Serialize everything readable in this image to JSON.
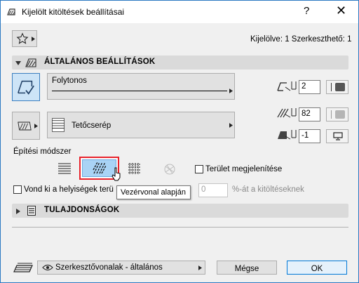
{
  "title": "Kijelölt kitöltések beállításai",
  "titlebar": {
    "help": "?",
    "close": "✕"
  },
  "selection_info": "Kijelölve: 1 Szerkeszthető: 1",
  "sections": {
    "general": "ÁLTALÁNOS BEÁLLÍTÁSOK",
    "properties": "TULAJDONSÁGOK"
  },
  "line_type": "Folytonos",
  "fill_type": "Tetőcserép",
  "pen_values": {
    "contour": "2",
    "fill": "82",
    "background": "-1"
  },
  "construction_method_label": "Építési módszer",
  "show_area_label": "Terület megjelenítése",
  "subtract_label": "Vond ki a helyiségek terü",
  "subtract_value": "0",
  "subtract_suffix": "%-át a kitöltéseknek",
  "tooltip": "Vezérvonal alapján",
  "footer": {
    "layer": "Szerkesztővonalak - általános",
    "cancel": "Mégse",
    "ok": "OK"
  },
  "colors": {
    "accent": "#2b79c2",
    "selected_method_bg": "#a9d3f5",
    "selected_method_border": "#e8212a"
  }
}
